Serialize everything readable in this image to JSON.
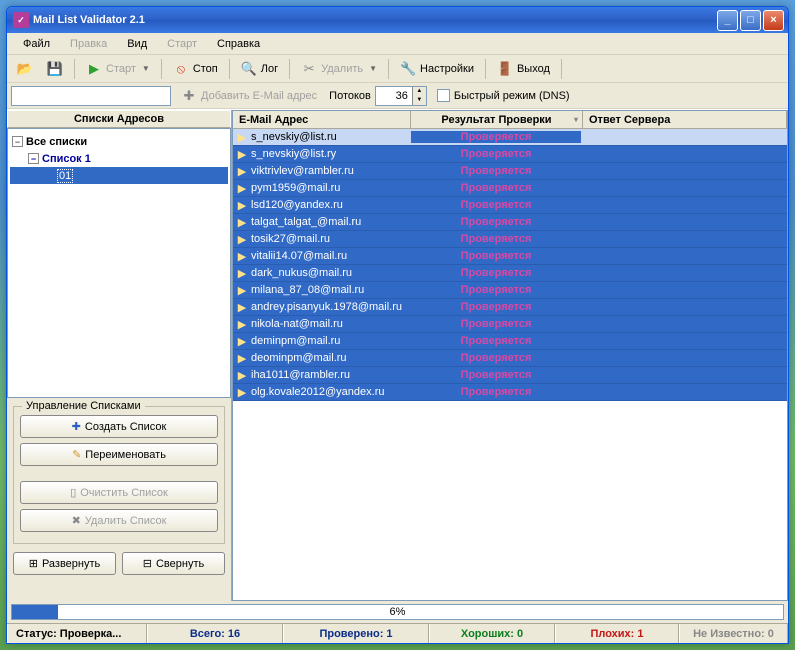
{
  "title": "Mail List Validator 2.1",
  "menu": {
    "file": "Файл",
    "edit": "Правка",
    "view": "Вид",
    "start": "Старт",
    "help": "Справка"
  },
  "toolbar": {
    "start": "Старт",
    "stop": "Стоп",
    "log": "Лог",
    "delete": "Удалить",
    "settings": "Настройки",
    "exit": "Выход",
    "add_mail": "Добавить E-Mail адрес",
    "threads_label": "Потоков",
    "threads_value": "36",
    "fast_mode": "Быстрый режим (DNS)"
  },
  "left": {
    "header": "Списки Адресов",
    "tree": {
      "root": "Все списки",
      "list1": "Список 1",
      "child": "01"
    },
    "group_legend": "Управление Списками",
    "create": "Создать Список",
    "rename": "Переименовать",
    "clear": "Очистить Список",
    "delete": "Удалить Список",
    "expand": "Развернуть",
    "collapse": "Свернуть"
  },
  "grid": {
    "h1": "E-Mail Адрес",
    "h2": "Результат Проверки",
    "h3": "Ответ Сервера",
    "status_checking": "Проверяется",
    "rows": [
      "s_nevskiy@list.ru",
      "s_nevskiy@list.ry",
      "viktrivlev@rambler.ru",
      "pym1959@mail.ru",
      "lsd120@yandex.ru",
      "talgat_talgat_@mail.ru",
      "tosik27@mail.ru",
      "vitalii14.07@mail.ru",
      "dark_nukus@mail.ru",
      "milana_87_08@mail.ru",
      "andrey.pisanyuk.1978@mail.ru",
      "nikola-nat@mail.ru",
      "deminpm@mail.ru",
      "deominpm@mail.ru",
      "iha1011@rambler.ru",
      "olg.kovale2012@yandex.ru"
    ]
  },
  "progress": {
    "percent": 6,
    "label": "6%"
  },
  "status": {
    "s1": "Статус: Проверка...",
    "s2": "Всего: 16",
    "s3": "Проверено: 1",
    "s4": "Хороших: 0",
    "s5": "Плохих: 1",
    "s6": "Не Известно: 0"
  }
}
